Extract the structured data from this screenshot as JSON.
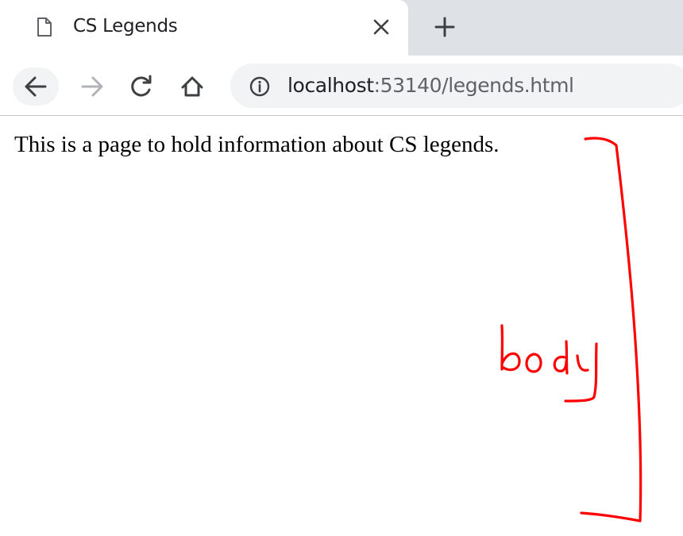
{
  "browser": {
    "tab": {
      "title": "CS Legends",
      "favicon_icon": "page-icon",
      "close_icon": "close-icon"
    },
    "new_tab_icon": "plus-icon",
    "toolbar": {
      "back_icon": "arrow-left-icon",
      "forward_icon": "arrow-right-icon",
      "reload_icon": "reload-icon",
      "home_icon": "home-icon"
    },
    "omnibox": {
      "info_icon": "info-icon",
      "url_host": "localhost",
      "url_rest": ":53140/legends.html"
    }
  },
  "page": {
    "body_text": "This is a page to hold information about CS legends."
  },
  "annotation": {
    "label": "body",
    "color": "#ff0000"
  }
}
